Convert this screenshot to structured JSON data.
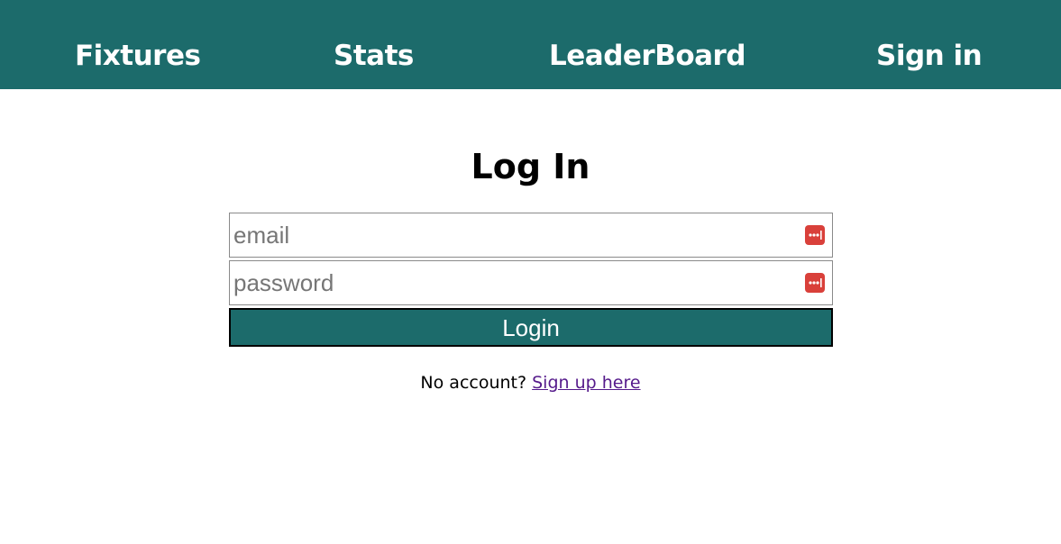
{
  "nav": {
    "items": [
      {
        "label": "Fixtures"
      },
      {
        "label": "Stats"
      },
      {
        "label": "LeaderBoard"
      },
      {
        "label": "Sign in"
      }
    ]
  },
  "login": {
    "title": "Log In",
    "email_placeholder": "email",
    "password_placeholder": "password",
    "submit_label": "Login",
    "no_account_text": "No account?",
    "signup_link_label": "Sign up here"
  },
  "icons": {
    "field_autofill": "password-manager-icon"
  },
  "colors": {
    "brand": "#1c6b6b",
    "nav_text": "#ffffff",
    "autofill_icon": "#d9403a",
    "visited_link": "#551a8b"
  }
}
